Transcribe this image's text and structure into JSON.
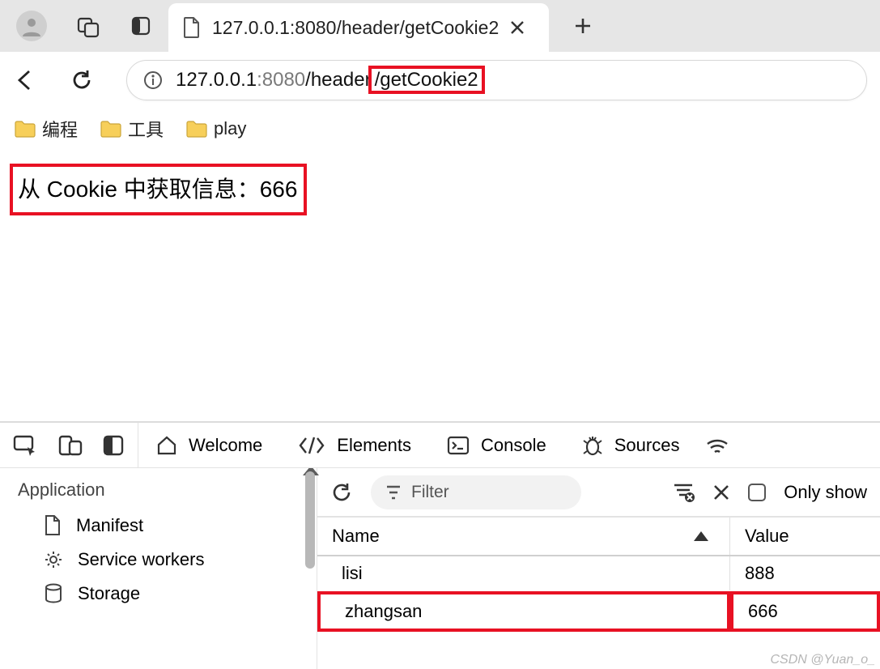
{
  "tab": {
    "title": "127.0.0.1:8080/header/getCookie2"
  },
  "url": {
    "host": "127.0.0.1",
    "port": ":8080",
    "path1": "/header",
    "path2": "/getCookie2"
  },
  "bookmarks": {
    "b1": "编程",
    "b2": "工具",
    "b3": "play"
  },
  "page": {
    "cookie_msg": "从 Cookie 中获取信息：666"
  },
  "devtools": {
    "tabs": {
      "welcome": "Welcome",
      "elements": "Elements",
      "console": "Console",
      "sources": "Sources"
    },
    "sidebar": {
      "heading": "Application",
      "manifest": "Manifest",
      "service_workers": "Service workers",
      "storage": "Storage"
    },
    "toolbar": {
      "filter_placeholder": "Filter",
      "only_show": "Only show "
    },
    "table": {
      "headers": {
        "name": "Name",
        "value": "Value"
      },
      "rows": [
        {
          "name": "lisi",
          "value": "888"
        },
        {
          "name": "zhangsan",
          "value": "666"
        }
      ]
    }
  },
  "watermark": "CSDN @Yuan_o_"
}
